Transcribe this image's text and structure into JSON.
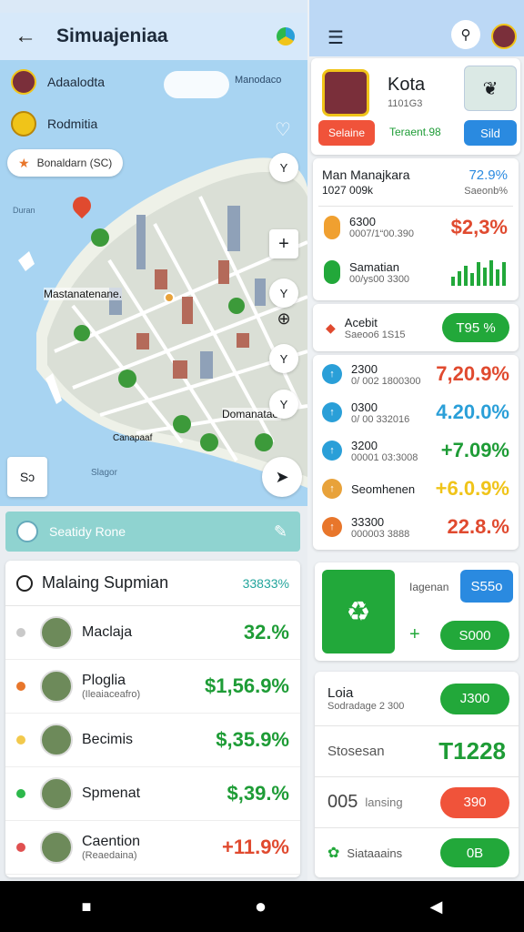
{
  "left": {
    "title": "Simuajeniaa",
    "map": {
      "legend1": "Adaalodta",
      "legend2": "Rodmitia",
      "top_right_label": "Manodaco",
      "chip": "Bonaldarn (SC)",
      "left_edge_label": "Duran",
      "district1": "Mastanatenane.",
      "district2": "Domanatae.",
      "district3": "Canapaaf",
      "sea_label": "Slagor",
      "zoom_in": "+",
      "map_btn": "⊕",
      "side_btn_labels": [
        "Y",
        "Y",
        "Y",
        "Y"
      ],
      "left_bottom_btn": "Sɔ"
    },
    "section": {
      "label": "Seatidy Rone"
    },
    "list": {
      "title": "Malaing Supmian",
      "value_header": "33833%",
      "rows": [
        {
          "name": "Maclaja",
          "sub": "",
          "value": "32.%",
          "color": "#1e9c36",
          "dot": "#c9c9c9"
        },
        {
          "name": "Ploglia",
          "sub": "(Ileaiaceafro)",
          "value": "$1,56.9%",
          "color": "#1e9c36",
          "dot": "#e8762b"
        },
        {
          "name": "Becimis",
          "sub": "",
          "value": "$,35.9%",
          "color": "#1e9c36",
          "dot": "#f2c94c"
        },
        {
          "name": "Spmenat",
          "sub": "",
          "value": "$,39.%",
          "color": "#1e9c36",
          "dot": "#2db84b"
        },
        {
          "name": "Caention",
          "sub": "(Reaedaina)",
          "value": "+11.9%",
          "color": "#e04a2f",
          "dot": "#e05050"
        }
      ]
    }
  },
  "right": {
    "profile": {
      "name": "Kota",
      "sub": "1101G3",
      "btn1": "Selaine",
      "status": "Teraent.98",
      "btn2": "Sild"
    },
    "stat": {
      "title": "Man Manajkara",
      "sub": "1027 009k",
      "value": "72.9%",
      "value_sub": "Saeonb%"
    },
    "chart_row": [
      {
        "label": "6300",
        "sub": "0007/1“00.390",
        "value": "$2,3%"
      },
      {
        "label": "Samatian",
        "sub": "00/ys00 3300",
        "value": ""
      }
    ],
    "action_row": {
      "label": "Acebit",
      "sub": "Saeoo6 1S15",
      "button": "T95 %"
    },
    "metrics": [
      {
        "label": "2300",
        "sub": "0/ 002 1800300",
        "value": "7,20.9%",
        "color": "#e04a2f",
        "dot": "#2a9fd8"
      },
      {
        "label": "0300",
        "sub": "0/ 00 332016",
        "value": "4.20.0%",
        "color": "#2a9fd8",
        "dot": "#2a9fd8"
      },
      {
        "label": "3200",
        "sub": "00001 03:3008",
        "value": "+7.09%",
        "color": "#1e9c36",
        "dot": "#2a9fd8"
      },
      {
        "label": "Seomhenen",
        "sub": "",
        "value": "+6.0.9%",
        "color": "#f0c419",
        "dot": "#e8a23a"
      },
      {
        "label": "33300",
        "sub": "000003 3888",
        "value": "22.8.%",
        "color": "#e04a2f",
        "dot": "#e8762b"
      }
    ],
    "promo": {
      "label": "Iagenan",
      "btn_top": "S55o",
      "plus": "+",
      "btn_bottom": "S000"
    },
    "bottom_rows": [
      {
        "label": "Loia",
        "sub": "Sodradage 2 300",
        "action": "J300",
        "action_color": "#22a83a"
      },
      {
        "label": "Stosesan",
        "sub": "",
        "action": "T1228",
        "action_color": ""
      },
      {
        "label": "005",
        "label2": "lansing",
        "sub": "",
        "action": "390",
        "action_color": "#f0533a"
      },
      {
        "label": "Siataaains",
        "sub": "",
        "action": "0B",
        "action_color": "#22a83a"
      }
    ]
  },
  "nav": {
    "back": "◀",
    "home": "●",
    "recent": "■"
  }
}
